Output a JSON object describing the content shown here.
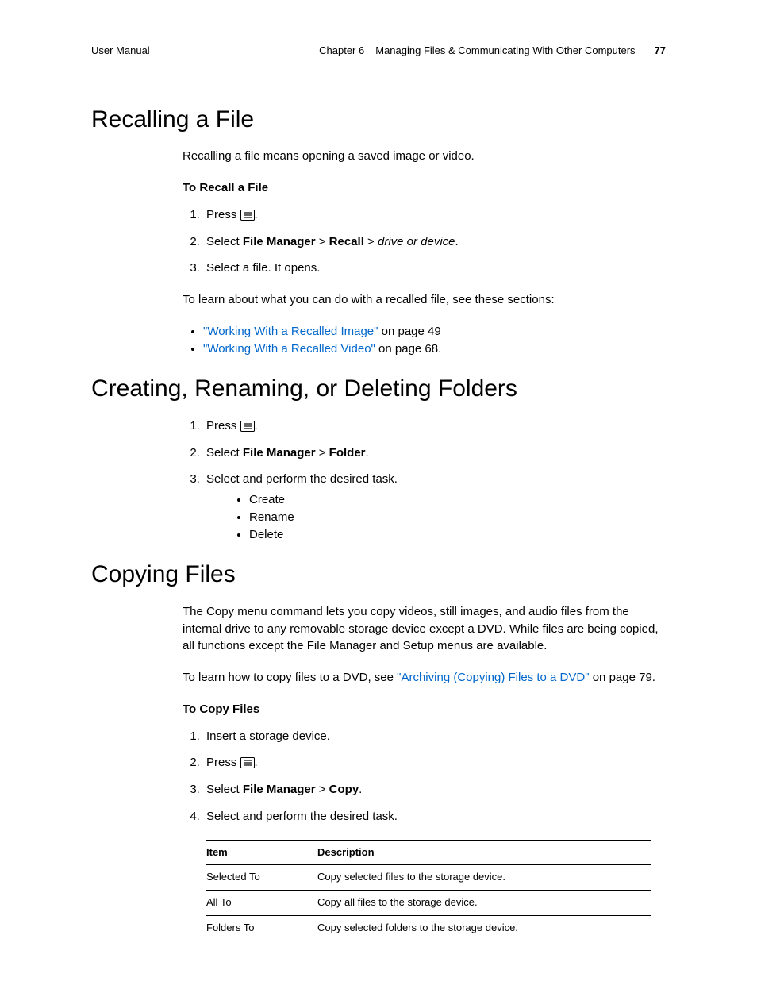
{
  "header": {
    "left": "User Manual",
    "chapter": "Chapter 6",
    "title": "Managing Files & Communicating With Other Computers",
    "page": "77"
  },
  "recall": {
    "heading": "Recalling a File",
    "intro": "Recalling a file means opening a saved image or video.",
    "sub": "To Recall a File",
    "step1_pre": "Press ",
    "step1_post": ".",
    "step2_pre": "Select ",
    "step2_fm": "File Manager",
    "step2_gt1": " > ",
    "step2_recall": "Recall",
    "step2_gt2": " > ",
    "step2_drive": "drive or device",
    "step2_post": ".",
    "step3": "Select a file. It opens.",
    "learn": "To learn about what you can do with a recalled file, see these sections:",
    "link1": "\"Working With a Recalled Image\"",
    "link1_post": " on page 49",
    "link2": "\"Working With a Recalled Video\"",
    "link2_post": " on page 68."
  },
  "folders": {
    "heading": "Creating, Renaming, or Deleting Folders",
    "step1_pre": "Press ",
    "step1_post": ".",
    "step2_pre": "Select ",
    "step2_fm": "File Manager",
    "step2_gt": " > ",
    "step2_folder": "Folder",
    "step2_post": ".",
    "step3": "Select and perform the desired task.",
    "tasks": {
      "a": "Create",
      "b": "Rename",
      "c": "Delete"
    }
  },
  "copy": {
    "heading": "Copying Files",
    "intro": "The Copy menu command lets you copy videos, still images, and audio files from the internal drive to any removable storage device except a DVD. While files are being copied, all functions except the File Manager and Setup menus are available.",
    "learn_pre": "To learn how to copy files to a DVD, see ",
    "link": "\"Archiving (Copying) Files to a DVD\"",
    "learn_post": " on page 79.",
    "sub": "To Copy Files",
    "step1": "Insert a storage device.",
    "step2_pre": "Press ",
    "step2_post": ".",
    "step3_pre": "Select ",
    "step3_fm": "File Manager",
    "step3_gt": " > ",
    "step3_copy": "Copy",
    "step3_post": ".",
    "step4": "Select and perform the desired task.",
    "table": {
      "h_item": "Item",
      "h_desc": "Description",
      "rows": [
        {
          "item": "Selected To",
          "desc": "Copy selected files to the storage device."
        },
        {
          "item": "All To",
          "desc": "Copy all files to the storage device."
        },
        {
          "item": "Folders To",
          "desc": "Copy selected folders to the storage device."
        }
      ]
    }
  }
}
